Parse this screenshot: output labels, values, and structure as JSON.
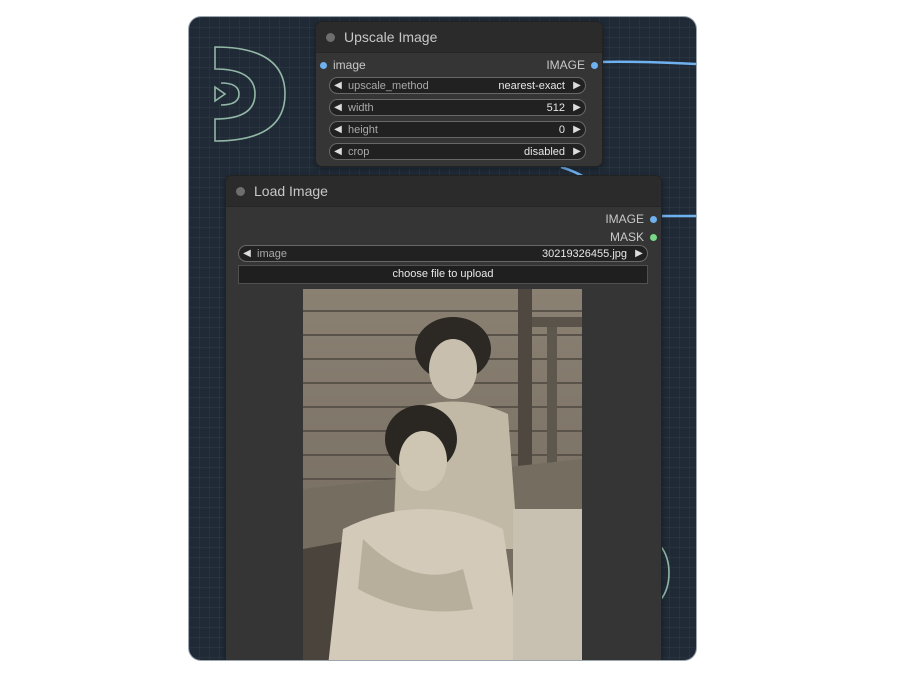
{
  "upscale_node": {
    "title": "Upscale Image",
    "input_label": "image",
    "output_label": "IMAGE",
    "widgets": [
      {
        "label": "upscale_method",
        "value": "nearest-exact"
      },
      {
        "label": "width",
        "value": "512"
      },
      {
        "label": "height",
        "value": "0"
      },
      {
        "label": "crop",
        "value": "disabled"
      }
    ]
  },
  "load_node": {
    "title": "Load Image",
    "outputs": [
      "IMAGE",
      "MASK"
    ],
    "image_widget": {
      "label": "image",
      "value": "30219326455.jpg"
    },
    "upload_button": "choose file to upload"
  },
  "icons": {
    "arrow_left": "◀",
    "arrow_right": "▶"
  },
  "colors": {
    "canvas_bg": "#1f2a36",
    "node_bg": "#353535",
    "node_header": "#2b2b2b",
    "wire_blue": "#6fb0ee",
    "mask_green": "#79d887",
    "logo_stroke": "#93b7a6"
  }
}
